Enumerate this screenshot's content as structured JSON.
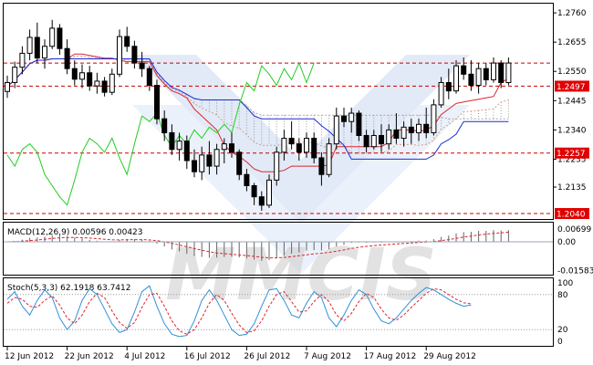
{
  "chart_data": [
    {
      "type": "candlestick",
      "price_axis_ticks": [
        "1.2760",
        "1.2655",
        "1.2550",
        "1.2445",
        "1.2340",
        "1.2235",
        "1.2135"
      ],
      "ylim": [
        1.204,
        1.278
      ],
      "date_ticks": [
        {
          "label": "12 Jun 2012",
          "bar": 0
        },
        {
          "label": "22 Jun 2012",
          "bar": 8
        },
        {
          "label": "4 Jul 2012",
          "bar": 16
        },
        {
          "label": "16 Jul 2012",
          "bar": 24
        },
        {
          "label": "26 Jul 2012",
          "bar": 32
        },
        {
          "label": "7 Aug 2012",
          "bar": 40
        },
        {
          "label": "17 Aug 2012",
          "bar": 48
        },
        {
          "label": "29 Aug 2012",
          "bar": 56
        }
      ],
      "levels": [
        {
          "value": 1.258,
          "label": ""
        },
        {
          "value": 1.2497,
          "label": "1.2497"
        },
        {
          "value": 1.2257,
          "label": "1.2257"
        },
        {
          "value": 1.204,
          "label": "1.2040"
        }
      ],
      "colors": {
        "up": "#ffffff",
        "down": "#000000",
        "level": "#cc0000",
        "level_tag": "#e00000",
        "tenkan": "#d9262e",
        "kijun": "#1a2bd8",
        "chikou": "#22cc22",
        "cloud": "#999999"
      },
      "ohlc": [
        [
          1.2478,
          1.2535,
          1.2455,
          1.251
        ],
        [
          1.251,
          1.2585,
          1.249,
          1.2565
        ],
        [
          1.2565,
          1.264,
          1.254,
          1.2615
        ],
        [
          1.2615,
          1.27,
          1.259,
          1.2672
        ],
        [
          1.2672,
          1.2725,
          1.258,
          1.2598
        ],
        [
          1.2598,
          1.2665,
          1.256,
          1.264
        ],
        [
          1.264,
          1.2735,
          1.263,
          1.2705
        ],
        [
          1.2705,
          1.272,
          1.261,
          1.2632
        ],
        [
          1.2632,
          1.2665,
          1.254,
          1.256
        ],
        [
          1.256,
          1.259,
          1.25,
          1.2522
        ],
        [
          1.2522,
          1.2575,
          1.249,
          1.2545
        ],
        [
          1.2545,
          1.257,
          1.248,
          1.2498
        ],
        [
          1.2498,
          1.2545,
          1.247,
          1.2515
        ],
        [
          1.2515,
          1.253,
          1.246,
          1.2475
        ],
        [
          1.2475,
          1.256,
          1.2465,
          1.254
        ],
        [
          1.254,
          1.27,
          1.253,
          1.2675
        ],
        [
          1.2675,
          1.271,
          1.262,
          1.264
        ],
        [
          1.264,
          1.266,
          1.256,
          1.258
        ],
        [
          1.258,
          1.262,
          1.253,
          1.256
        ],
        [
          1.256,
          1.257,
          1.248,
          1.25
        ],
        [
          1.25,
          1.252,
          1.236,
          1.238
        ],
        [
          1.238,
          1.241,
          1.23,
          1.233
        ],
        [
          1.233,
          1.236,
          1.225,
          1.227
        ],
        [
          1.227,
          1.233,
          1.223,
          1.23
        ],
        [
          1.23,
          1.232,
          1.22,
          1.223
        ],
        [
          1.223,
          1.227,
          1.217,
          1.219
        ],
        [
          1.219,
          1.228,
          1.216,
          1.225
        ],
        [
          1.225,
          1.23,
          1.218,
          1.221
        ],
        [
          1.221,
          1.229,
          1.218,
          1.227
        ],
        [
          1.227,
          1.231,
          1.222,
          1.229
        ],
        [
          1.229,
          1.233,
          1.224,
          1.226
        ],
        [
          1.226,
          1.227,
          1.216,
          1.218
        ],
        [
          1.218,
          1.22,
          1.212,
          1.214
        ],
        [
          1.214,
          1.215,
          1.207,
          1.21
        ],
        [
          1.21,
          1.212,
          1.205,
          1.207
        ],
        [
          1.207,
          1.218,
          1.206,
          1.216
        ],
        [
          1.216,
          1.228,
          1.214,
          1.226
        ],
        [
          1.226,
          1.234,
          1.223,
          1.231
        ],
        [
          1.231,
          1.237,
          1.227,
          1.229
        ],
        [
          1.229,
          1.231,
          1.223,
          1.226
        ],
        [
          1.226,
          1.233,
          1.224,
          1.231
        ],
        [
          1.231,
          1.233,
          1.222,
          1.224
        ],
        [
          1.224,
          1.226,
          1.214,
          1.218
        ],
        [
          1.218,
          1.231,
          1.217,
          1.229
        ],
        [
          1.229,
          1.242,
          1.227,
          1.239
        ],
        [
          1.239,
          1.242,
          1.235,
          1.237
        ],
        [
          1.237,
          1.242,
          1.233,
          1.24
        ],
        [
          1.24,
          1.241,
          1.23,
          1.232
        ],
        [
          1.232,
          1.234,
          1.226,
          1.228
        ],
        [
          1.228,
          1.234,
          1.227,
          1.232
        ],
        [
          1.232,
          1.236,
          1.226,
          1.229
        ],
        [
          1.229,
          1.236,
          1.227,
          1.234
        ],
        [
          1.234,
          1.24,
          1.229,
          1.231
        ],
        [
          1.231,
          1.237,
          1.228,
          1.235
        ],
        [
          1.235,
          1.238,
          1.229,
          1.233
        ],
        [
          1.233,
          1.238,
          1.23,
          1.236
        ],
        [
          1.236,
          1.242,
          1.231,
          1.233
        ],
        [
          1.233,
          1.245,
          1.232,
          1.243
        ],
        [
          1.243,
          1.253,
          1.242,
          1.251
        ],
        [
          1.251,
          1.256,
          1.245,
          1.248
        ],
        [
          1.248,
          1.259,
          1.247,
          1.257
        ],
        [
          1.257,
          1.26,
          1.252,
          1.254
        ],
        [
          1.254,
          1.259,
          1.248,
          1.25
        ],
        [
          1.25,
          1.258,
          1.247,
          1.256
        ],
        [
          1.256,
          1.258,
          1.25,
          1.252
        ],
        [
          1.252,
          1.26,
          1.251,
          1.258
        ],
        [
          1.258,
          1.259,
          1.249,
          1.251
        ],
        [
          1.251,
          1.26,
          1.25,
          1.258
        ]
      ]
    },
    {
      "type": "macd",
      "label": "MACD(12,26,9) 0.00596 0.00423",
      "ticks": [
        "0.00699",
        "0.00",
        "-0.01583"
      ],
      "ylim": [
        -0.0175,
        0.0075
      ]
    },
    {
      "type": "stochastic",
      "label": "Stoch(5,3,3) 62.1918 63.7412",
      "ticks": [
        "100",
        "80",
        "20",
        "0"
      ],
      "ylim": [
        0,
        100
      ],
      "colors": {
        "main": "#2f8fd8",
        "signal": "#d9262e"
      },
      "main": [
        72,
        85,
        60,
        45,
        70,
        88,
        75,
        40,
        20,
        35,
        70,
        90,
        80,
        55,
        30,
        15,
        20,
        50,
        85,
        95,
        60,
        30,
        12,
        8,
        10,
        35,
        70,
        88,
        70,
        45,
        20,
        10,
        12,
        30,
        60,
        88,
        90,
        70,
        45,
        40,
        65,
        85,
        75,
        40,
        25,
        45,
        70,
        88,
        80,
        55,
        35,
        30,
        40,
        55,
        70,
        82,
        92,
        88,
        80,
        72,
        65,
        60,
        62
      ],
      "signal": [
        65,
        75,
        72,
        60,
        58,
        70,
        78,
        62,
        40,
        30,
        45,
        68,
        82,
        75,
        52,
        32,
        22,
        32,
        58,
        80,
        82,
        60,
        35,
        18,
        12,
        20,
        40,
        65,
        80,
        70,
        48,
        28,
        15,
        18,
        35,
        60,
        80,
        85,
        68,
        50,
        52,
        68,
        80,
        68,
        45,
        35,
        48,
        68,
        82,
        75,
        55,
        40,
        36,
        45,
        58,
        70,
        82,
        90,
        88,
        80,
        72,
        66,
        64
      ]
    }
  ],
  "watermark": "MMCIS"
}
